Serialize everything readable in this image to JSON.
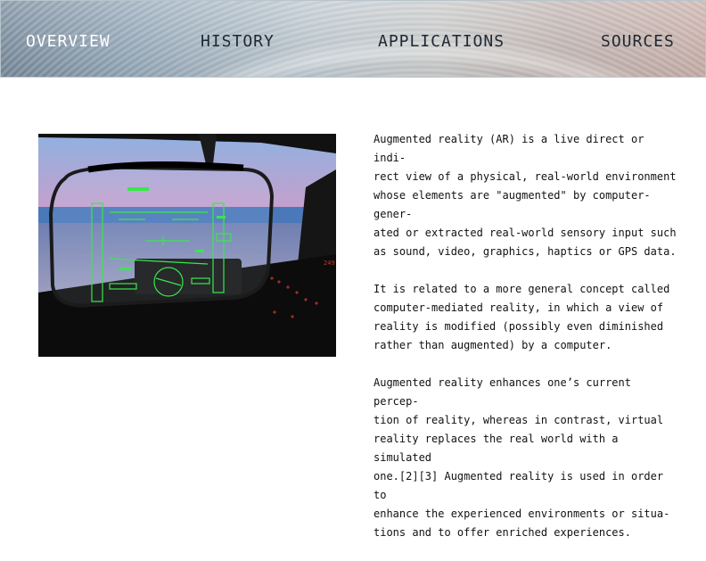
{
  "nav": {
    "items": [
      {
        "label": "OVERVIEW",
        "active": true
      },
      {
        "label": "HISTORY",
        "active": false
      },
      {
        "label": "APPLICATIONS",
        "active": false
      },
      {
        "label": "SOURCES",
        "active": false
      }
    ],
    "active_color": "#ffffff",
    "inactive_color": "#1e2933"
  },
  "image": {
    "subject": "cockpit head-up display (HUD) view over the sea",
    "hud_color": "#38e84a",
    "hud_readouts": [
      "249"
    ]
  },
  "article": {
    "paragraphs": [
      "Augmented reality (AR) is a live direct or indi-\nrect view of a physical, real-world environment\nwhose elements are \"augmented\" by computer-gener-\nated or extracted real-world sensory input such\nas sound, video, graphics, haptics or GPS data.",
      "It is related to a more general concept called\ncomputer-mediated reality, in which a view of\nreality is modified (possibly even diminished\nrather than augmented) by a computer.",
      "Augmented reality enhances one’s current percep-\ntion of reality, whereas in contrast, virtual\nreality replaces the real world with a simulated\none.[2][3] Augmented reality is used in order to\nenhance the experienced environments or situa-\ntions and to offer enriched experiences."
    ]
  }
}
